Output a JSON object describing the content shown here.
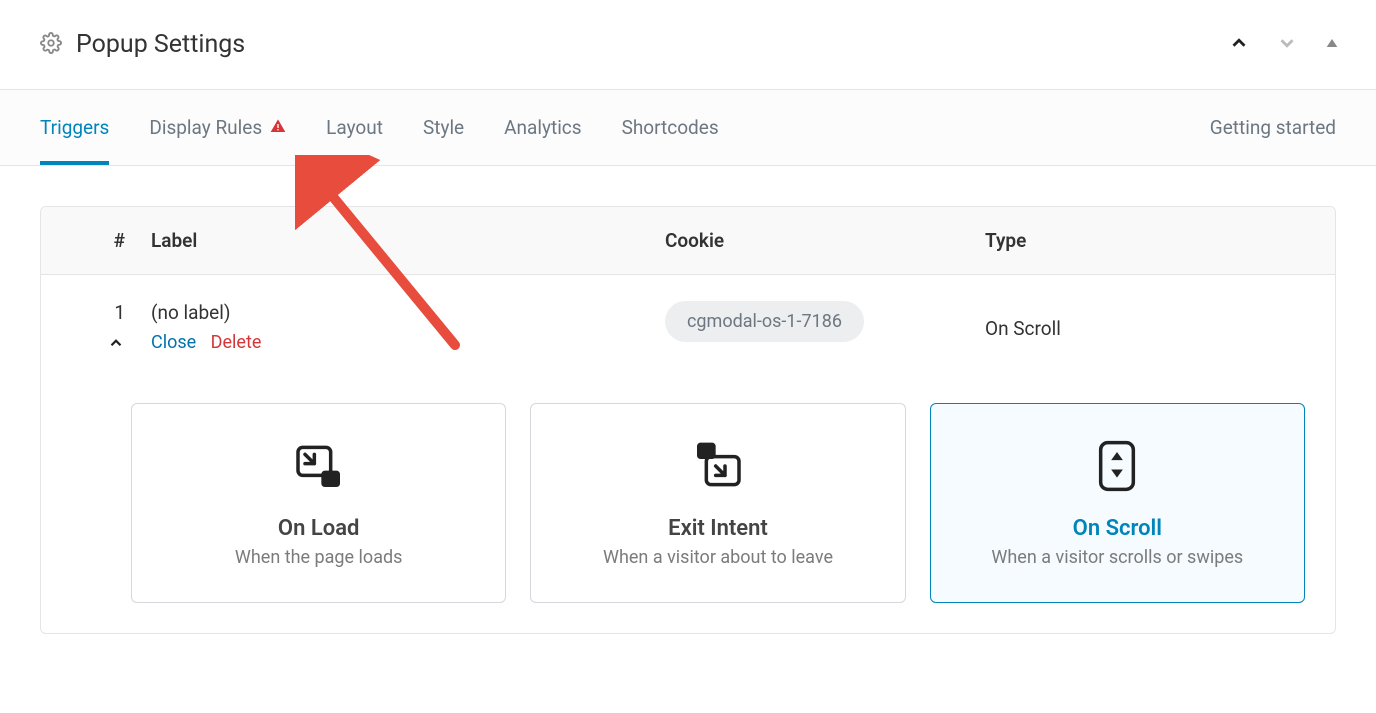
{
  "header": {
    "title": "Popup Settings"
  },
  "tabs": {
    "items": [
      {
        "key": "triggers",
        "label": "Triggers",
        "active": true,
        "warn": false
      },
      {
        "key": "display-rules",
        "label": "Display Rules",
        "active": false,
        "warn": true
      },
      {
        "key": "layout",
        "label": "Layout",
        "active": false,
        "warn": false
      },
      {
        "key": "style",
        "label": "Style",
        "active": false,
        "warn": false
      },
      {
        "key": "analytics",
        "label": "Analytics",
        "active": false,
        "warn": false
      },
      {
        "key": "shortcodes",
        "label": "Shortcodes",
        "active": false,
        "warn": false
      }
    ],
    "right": "Getting started"
  },
  "table": {
    "headers": {
      "idx": "#",
      "label": "Label",
      "cookie": "Cookie",
      "type": "Type"
    },
    "rows": [
      {
        "idx": "1",
        "label": "(no label)",
        "cookie": "cgmodal-os-1-7186",
        "type": "On Scroll",
        "actions": {
          "close": "Close",
          "delete": "Delete"
        }
      }
    ]
  },
  "cards": [
    {
      "key": "on-load",
      "title": "On Load",
      "sub": "When the page loads",
      "selected": false
    },
    {
      "key": "exit-intent",
      "title": "Exit Intent",
      "sub": "When a visitor about to leave",
      "selected": false
    },
    {
      "key": "on-scroll",
      "title": "On Scroll",
      "sub": "When a visitor scrolls or swipes",
      "selected": true
    }
  ]
}
